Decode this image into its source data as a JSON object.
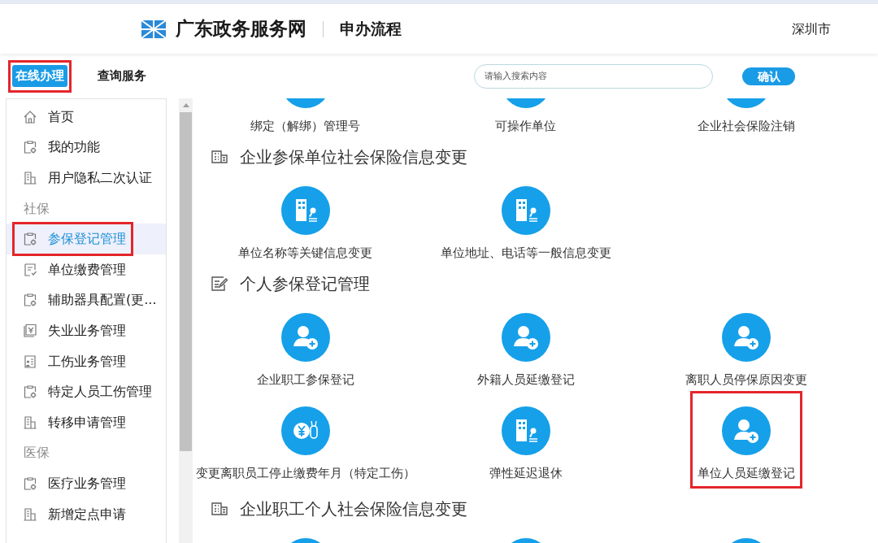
{
  "header": {
    "site_title": "广东政务服务网",
    "page_title": "申办流程",
    "location": "深圳市"
  },
  "nav": {
    "tabs": [
      {
        "label": "在线办理",
        "selected": true
      },
      {
        "label": "查询服务",
        "selected": false
      }
    ],
    "search": {
      "placeholder": "请输入搜索内容"
    },
    "confirm_button": "确认"
  },
  "sidebar": {
    "items": [
      {
        "kind": "home",
        "label": "首页",
        "selected": false
      },
      {
        "kind": "clipboard",
        "label": "我的功能",
        "selected": false
      },
      {
        "kind": "building",
        "label": "用户隐私二次认证",
        "selected": false
      },
      {
        "kind": "group",
        "label": "社保"
      },
      {
        "kind": "clipboard",
        "label": "参保登记管理",
        "selected": true
      },
      {
        "kind": "invoice",
        "label": "单位缴费管理",
        "selected": false
      },
      {
        "kind": "clipboard",
        "label": "辅助器具配置(更...",
        "selected": false
      },
      {
        "kind": "money",
        "label": "失业业务管理",
        "selected": false
      },
      {
        "kind": "idcard",
        "label": "工伤业务管理",
        "selected": false
      },
      {
        "kind": "clipboard",
        "label": "特定人员工伤管理",
        "selected": false
      },
      {
        "kind": "building",
        "label": "转移申请管理",
        "selected": false
      },
      {
        "kind": "group",
        "label": "医保"
      },
      {
        "kind": "clipboard",
        "label": "医疗业务管理",
        "selected": false
      },
      {
        "kind": "building",
        "label": "新增定点申请",
        "selected": false
      }
    ]
  },
  "sections": [
    {
      "tiles": [
        {
          "kind": "cropped",
          "label": "绑定（解绑）管理号",
          "highlighted": false
        },
        {
          "kind": "cropped",
          "label": "可操作单位",
          "highlighted": false
        },
        {
          "kind": "cropped",
          "label": "企业社会保险注销",
          "highlighted": false
        }
      ]
    },
    {
      "kind": "building",
      "heading": "企业参保单位社会保险信息变更",
      "tiles": [
        {
          "kind": "building",
          "label": "单位名称等关键信息变更",
          "highlighted": false
        },
        {
          "kind": "building",
          "label": "单位地址、电话等一般信息变更",
          "highlighted": false
        }
      ]
    },
    {
      "kind": "edit",
      "heading": "个人参保登记管理",
      "tiles": [
        {
          "kind": "person",
          "label": "企业职工参保登记",
          "highlighted": false
        },
        {
          "kind": "person",
          "label": "外籍人员延缴登记",
          "highlighted": false
        },
        {
          "kind": "person",
          "label": "离职人员停保原因变更",
          "highlighted": false
        },
        {
          "kind": "money",
          "label": "变更离职员工停止缴费年月（特定工伤）",
          "highlighted": false
        },
        {
          "kind": "building",
          "label": "弹性延迟退休",
          "highlighted": false
        },
        {
          "kind": "person",
          "label": "单位人员延缴登记",
          "highlighted": true
        }
      ]
    },
    {
      "kind": "building",
      "heading": "企业职工个人社会保险信息变更",
      "tiles": [
        {
          "kind": "cropped",
          "highlighted": false
        },
        {
          "kind": "cropped",
          "highlighted": false
        },
        {
          "kind": "cropped",
          "highlighted": false
        }
      ]
    }
  ]
}
